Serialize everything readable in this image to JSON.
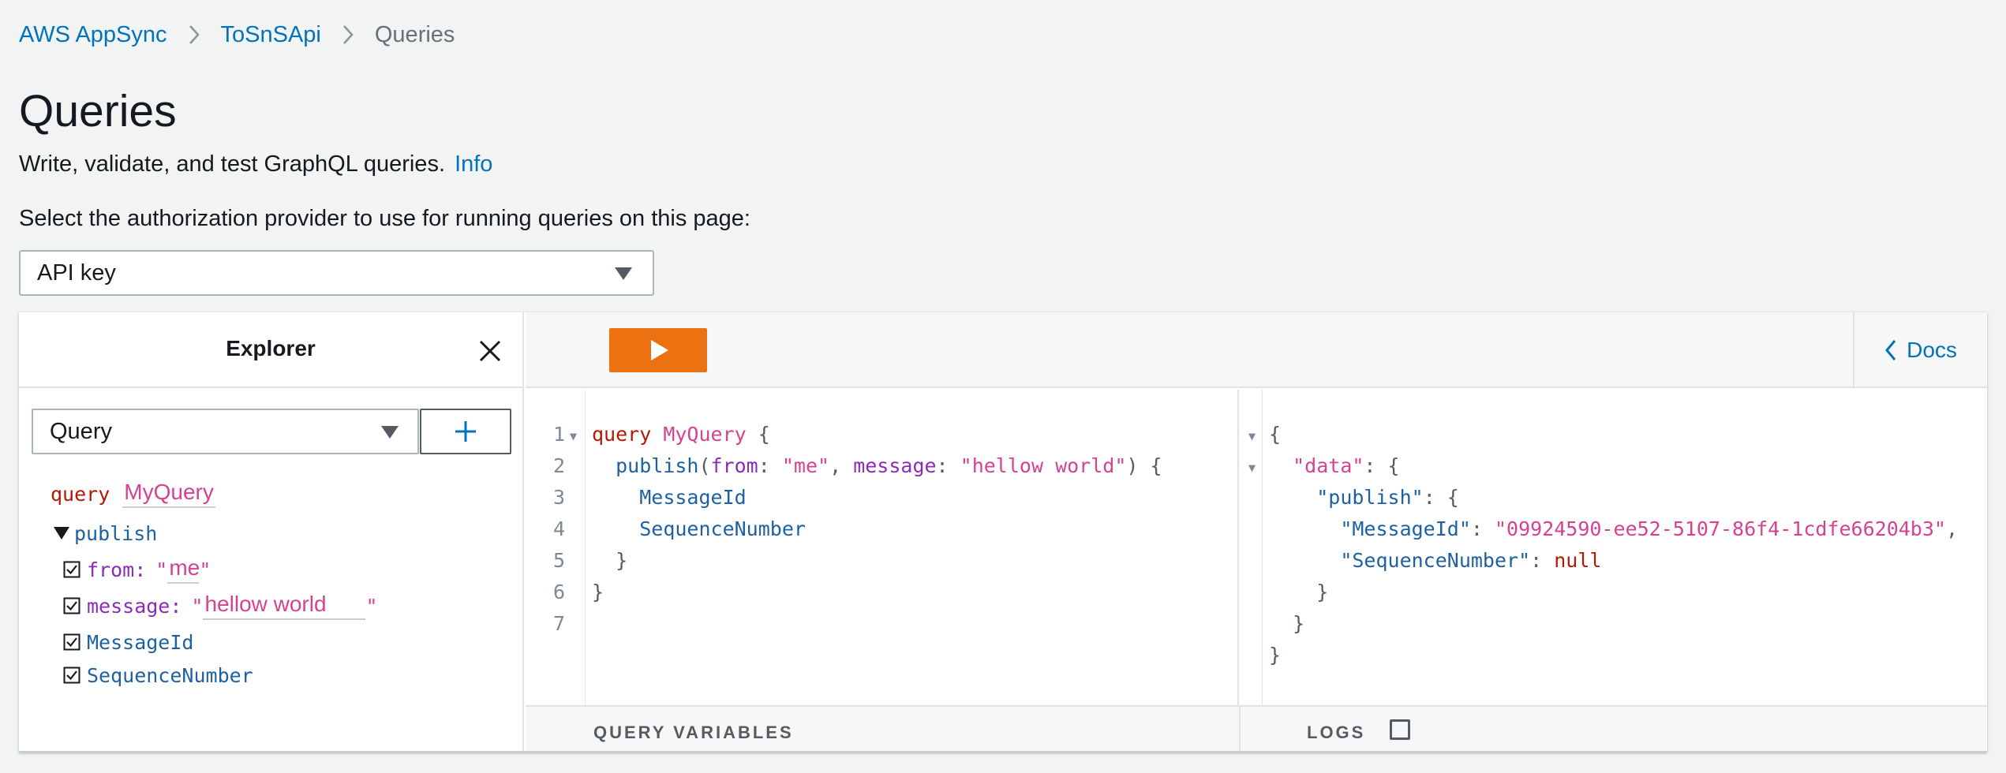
{
  "breadcrumb": {
    "items": [
      {
        "label": "AWS AppSync"
      },
      {
        "label": "ToSnSApi"
      },
      {
        "label": "Queries"
      }
    ]
  },
  "page": {
    "title": "Queries",
    "description": "Write, validate, and test GraphQL queries.",
    "info_link": "Info",
    "auth_label": "Select the authorization provider to use for running queries on this page:"
  },
  "auth_select": {
    "value": "API key"
  },
  "explorer": {
    "title": "Explorer",
    "operation_type": "Query",
    "query_keyword": "query",
    "operation_name": "MyQuery",
    "root_field": "publish",
    "args": [
      {
        "name": "from:",
        "value": "me",
        "checked": true
      },
      {
        "name": "message:",
        "value": "hellow world",
        "checked": true
      }
    ],
    "fields": [
      {
        "name": "MessageId",
        "checked": true
      },
      {
        "name": "SequenceNumber",
        "checked": true
      }
    ]
  },
  "toolbar": {
    "docs_label": "Docs"
  },
  "editor": {
    "line_numbers": [
      "1",
      "2",
      "3",
      "4",
      "5",
      "6",
      "7"
    ],
    "tokens": {
      "query_kw": "query",
      "op_name": "MyQuery",
      "open_brace": "{",
      "close_brace": "}",
      "publish": "publish",
      "from_arg": "from",
      "from_val": "\"me\"",
      "message_arg": "message",
      "message_val": "\"hellow world\"",
      "field1": "MessageId",
      "field2": "SequenceNumber"
    }
  },
  "result": {
    "data_key": "\"data\"",
    "publish_key": "\"publish\"",
    "message_id_key": "\"MessageId\"",
    "message_id_value": "\"09924590-ee52-5107-86f4-1cdfe66204b3\"",
    "sequence_key": "\"SequenceNumber\"",
    "sequence_value": "null"
  },
  "bottom": {
    "query_variables": "QUERY VARIABLES",
    "logs": "LOGS"
  },
  "colors": {
    "link": "#0073bb",
    "run_button": "#ec7211",
    "keyword": "#b11a04",
    "string": "#d64292",
    "field": "#1f61a0",
    "argument": "#8b2bb9"
  }
}
